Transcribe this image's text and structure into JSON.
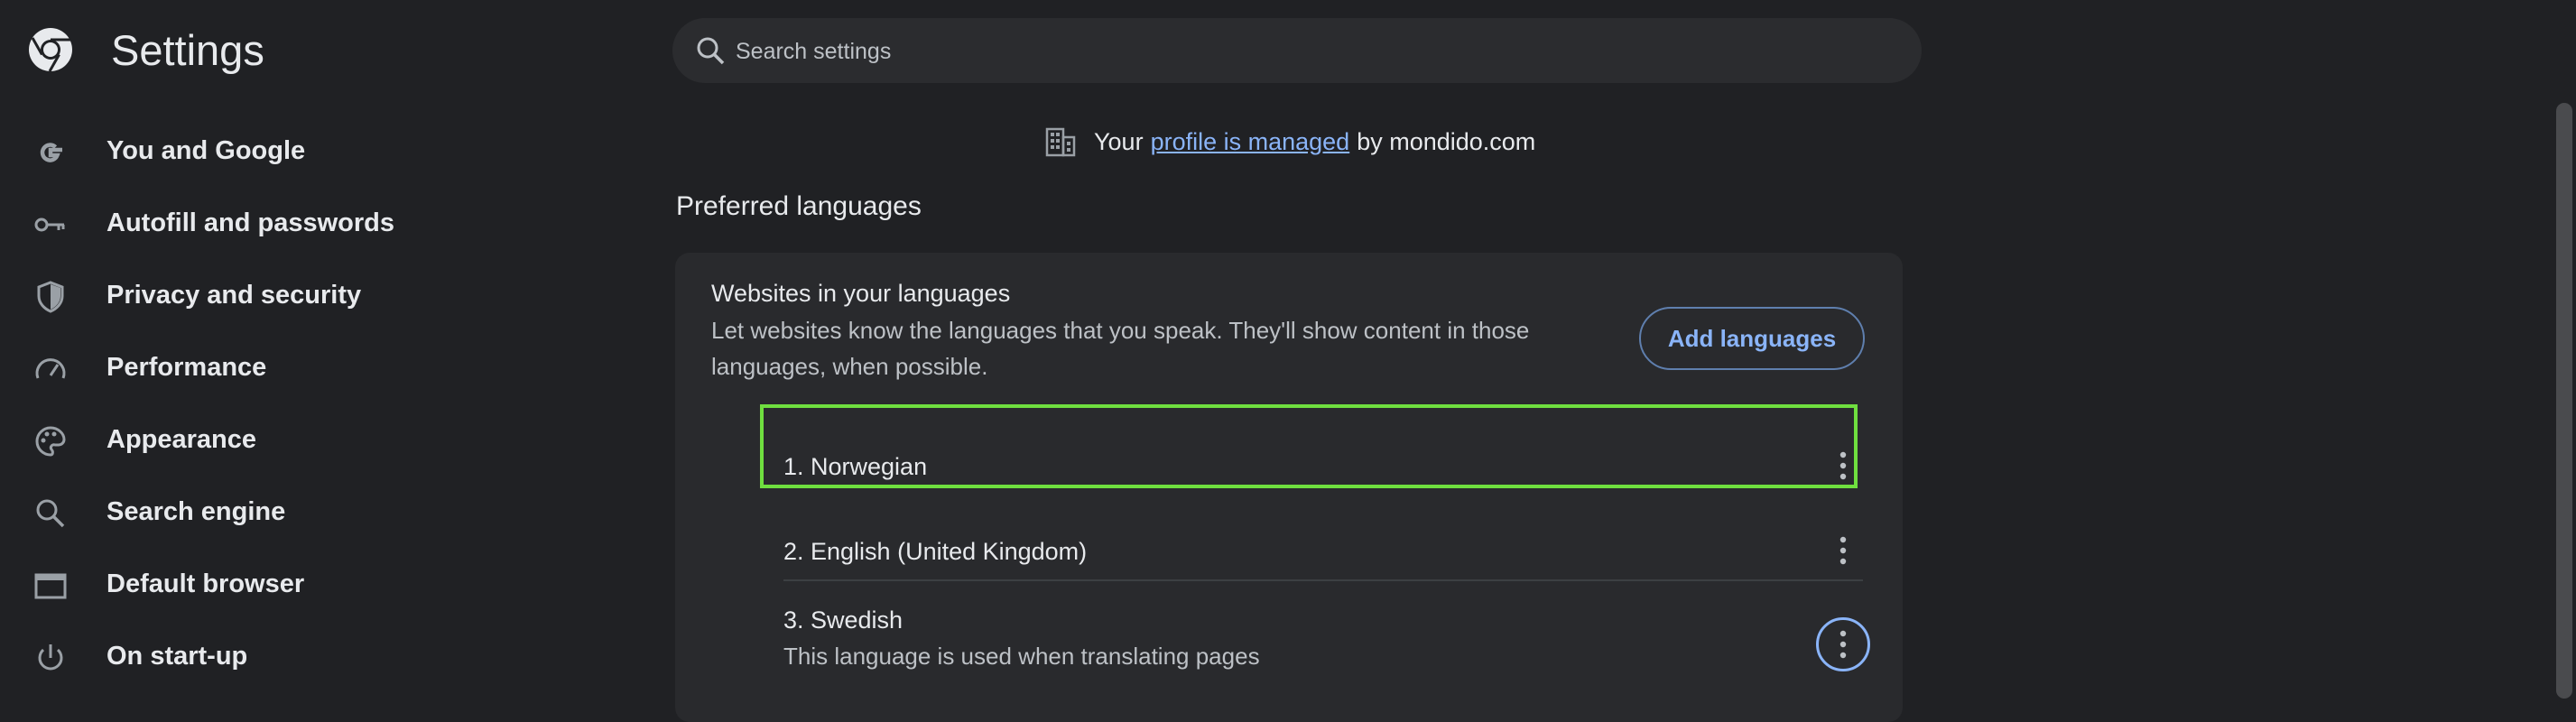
{
  "header": {
    "title": "Settings",
    "logo_icon": "chrome-logo-icon"
  },
  "search": {
    "placeholder": "Search settings"
  },
  "sidebar": {
    "items": [
      {
        "label": "You and Google",
        "icon": "google-g-icon"
      },
      {
        "label": "Autofill and passwords",
        "icon": "key-icon"
      },
      {
        "label": "Privacy and security",
        "icon": "shield-icon"
      },
      {
        "label": "Performance",
        "icon": "speedometer-icon"
      },
      {
        "label": "Appearance",
        "icon": "palette-icon"
      },
      {
        "label": "Search engine",
        "icon": "search-icon"
      },
      {
        "label": "Default browser",
        "icon": "browser-window-icon"
      },
      {
        "label": "On start-up",
        "icon": "power-icon"
      }
    ]
  },
  "managed": {
    "prefix": "Your",
    "link": "profile is managed",
    "suffix": "by mondido.com"
  },
  "section": {
    "title": "Preferred languages"
  },
  "card": {
    "heading": "Websites in your languages",
    "description": "Let websites know the languages that you speak. They'll show content in those languages, when possible.",
    "add_button": "Add languages"
  },
  "languages": [
    {
      "label": "1. Norwegian"
    },
    {
      "label": "2. English (United Kingdom)"
    },
    {
      "label": "3. Swedish",
      "note": "This language is used when translating pages"
    }
  ],
  "colors": {
    "accent": "#8ab4f8",
    "highlight": "#6fdf3f",
    "background": "#202124",
    "card": "#292a2d"
  }
}
